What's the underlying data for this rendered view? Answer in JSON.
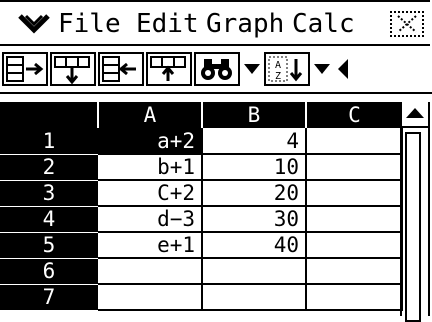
{
  "menubar": {
    "menu_icon": "double-chevron-down-icon",
    "items": [
      "File",
      "Edit",
      "Graph",
      "Calc"
    ],
    "close_icon": "close-icon"
  },
  "toolbar": {
    "buttons": [
      {
        "name": "insert-row-right-icon"
      },
      {
        "name": "insert-row-below-icon"
      },
      {
        "name": "insert-row-left-icon"
      },
      {
        "name": "insert-column-icon"
      },
      {
        "name": "binoculars-search-icon"
      },
      {
        "name": "dropdown-arrow-icon"
      },
      {
        "name": "sort-az-icon"
      },
      {
        "name": "dropdown-arrow-icon"
      },
      {
        "name": "scroll-left-icon"
      }
    ]
  },
  "sheet": {
    "columns": [
      "A",
      "B",
      "C"
    ],
    "rows": [
      {
        "num": "1",
        "A": "a+2",
        "B": "4",
        "C": ""
      },
      {
        "num": "2",
        "A": "b+1",
        "B": "10",
        "C": ""
      },
      {
        "num": "3",
        "A": "C+2",
        "B": "20",
        "C": ""
      },
      {
        "num": "4",
        "A": "d−3",
        "B": "30",
        "C": ""
      },
      {
        "num": "5",
        "A": "e+1",
        "B": "40",
        "C": ""
      },
      {
        "num": "6",
        "A": "",
        "B": "",
        "C": ""
      },
      {
        "num": "7",
        "A": "",
        "B": "",
        "C": ""
      }
    ],
    "selected_cell": "A1"
  }
}
